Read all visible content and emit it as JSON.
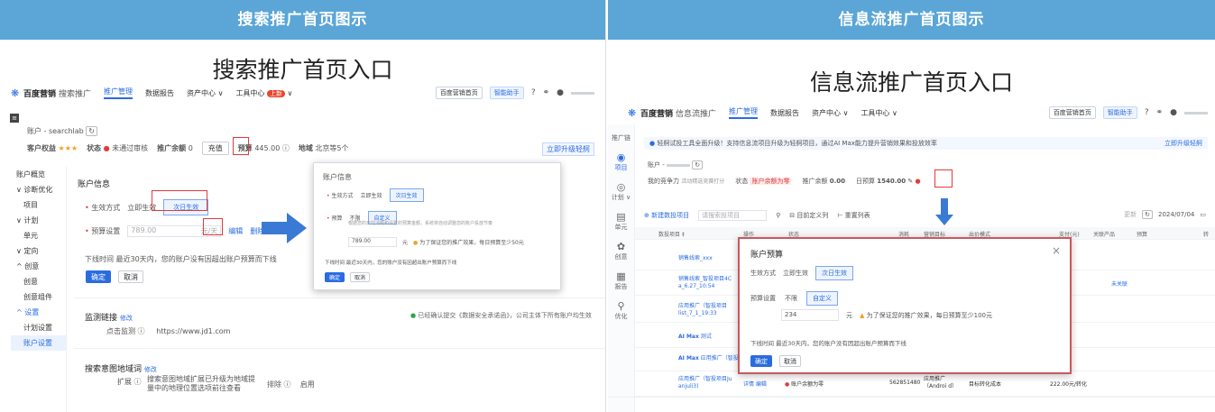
{
  "left": {
    "banner": "搜索推广首页图示",
    "title": "搜索推广首页入口",
    "nav": {
      "logo": "百度营销",
      "product": "搜索推广",
      "items": [
        "推广管理",
        "数据报告",
        "资产中心 ∨",
        "工具中心"
      ],
      "new_badge": "上新",
      "right_pill": "百度营销首页",
      "assistant_pill": "智能助手"
    },
    "account": {
      "label": "账户 - searchlab",
      "customer_rights_label": "客户权益",
      "stars": "★★★",
      "status_label": "状态",
      "status_value": "未通过审核",
      "balance_label": "推广余额",
      "balance_value": "0",
      "recharge": "充值",
      "budget_label": "预算",
      "budget_value": "445.00",
      "region_label": "地域",
      "region_value": "北京等5个",
      "upgrade": "立即升级轻舸"
    },
    "sidebar": [
      "账户概览",
      "诊断优化",
      "项目",
      "计划",
      "单元",
      "定向",
      "创意",
      "创意",
      "创意组件",
      "设置",
      "计划设置",
      "账户设置"
    ],
    "account_info": {
      "heading": "账户信息",
      "effect_label": "生效方式",
      "effect_now": "立即生效",
      "effect_next": "次日生效",
      "budget_label": "预算设置",
      "budget_placeholder": "789.00",
      "budget_unit": "元/天",
      "budget_edit": "编辑",
      "budget_delete": "删除",
      "note": "下线时间  最近30天内，您的账户没有因超出账户预算而下线",
      "confirm": "确定",
      "cancel": "取消"
    },
    "monitor": {
      "heading": "监测链接",
      "edit": "修改",
      "click_label": "点击监测",
      "click_value": "https://www.jd1.com",
      "notice": "已经确认提交《数据安全承诺函》，公司主体下所有账户均生效"
    },
    "region": {
      "heading": "搜索意图地域词",
      "edit": "修改",
      "expand_label": "扩展",
      "expand_text_1": "搜索意图地域扩展已升级为地域提",
      "expand_text_2": "量中的地理位置选项前往查看",
      "exclude_label": "排除",
      "exclude_value": "启用"
    },
    "popup": {
      "heading": "账户信息",
      "effect_label": "生效方式",
      "effect_now": "立即生效",
      "effect_next": "次日生效",
      "budget_label": "预算",
      "opt_none": "不限",
      "opt_custom": "自定义",
      "desc": "根据您的日均消耗和设置的预算金额，系统将自动调整您的账户投放节奏",
      "amount": "789.00",
      "unit": "元",
      "tip": "为了保证您的推广效果，每日预算至少50元",
      "note": "下线时间  最近30天内，您的账户没有因超出账户预算而下线",
      "confirm": "确定",
      "cancel": "取消"
    }
  },
  "right": {
    "banner": "信息流推广首页图示",
    "title": "信息流推广首页入口",
    "nav": {
      "logo": "百度营销",
      "product": "信息流推广",
      "items": [
        "推广管理",
        "数据报告",
        "资产中心 ∨",
        "工具中心 ∨"
      ],
      "right_pill": "百度营销首页",
      "assistant_pill": "智能助手"
    },
    "rail": [
      "推广链",
      "项目",
      "计划 ∨",
      "单元",
      "创意",
      "报告",
      "优化"
    ],
    "notice": "轻舸试投工具全面升级！支持信息流项目升级为轻舸项目，通过AI Max能力提升营销效果和投放效率",
    "notice_link": "立即升级轻舸",
    "account": {
      "label": "账户 -",
      "competition_label": "我的竞争力",
      "competition_value": "活动精选竞赛打分",
      "status_label": "状态",
      "status_value": "账户余额为零",
      "balance_label": "推广余额",
      "balance_value": "0.00",
      "budget_label": "日预算",
      "budget_value": "1540.00"
    },
    "toolbar": {
      "new_project": "新建数投项目",
      "search_placeholder": "请搜索投项目",
      "filter": "目前定义列",
      "reset": "重置列表",
      "date": "2024/07/04"
    },
    "table": {
      "headers": [
        "数投项目 ‡",
        "操作",
        "状态",
        "消耗",
        "营销目标",
        "出价模式",
        "支付(元)",
        "关联产品",
        "预算",
        "转"
      ],
      "rows": [
        {
          "name": "销售线索_xxx",
          "extra": ""
        },
        {
          "name": "销售线索_智投项目4C",
          "sub": "a_6.27_10:54",
          "extra": "未关联"
        },
        {
          "name": "应用推广（智投项目",
          "sub": "list_7_1_19:33",
          "extra": ""
        },
        {
          "name": "AI Max",
          "sub": "测试",
          "extra": ""
        },
        {
          "name": "AI Max",
          "sub": "应用推广（智投...",
          "extra": ""
        },
        {
          "name": "应用推广（智投项目Ju",
          "sub": "anjuli3)",
          "op": "详情  编辑",
          "status": "账户余额为零",
          "cost": "562851480",
          "goal": "应用推广（Androi d）",
          "bid": "目标转化成本",
          "pay": "222.00元/转化"
        }
      ]
    },
    "popup": {
      "heading": "账户预算",
      "close": "×",
      "effect_label": "生效方式",
      "effect_now": "立即生效",
      "effect_next": "次日生效",
      "budget_label": "预算设置",
      "opt_none": "不限",
      "opt_custom": "自定义",
      "amount": "234",
      "unit": "元",
      "tip": "为了保证您的推广效果，每日预算至少100元",
      "note": "下线时间  最近30天内，您的账户没有因超出账户预算而下线",
      "confirm": "确定",
      "cancel": "取消"
    }
  }
}
